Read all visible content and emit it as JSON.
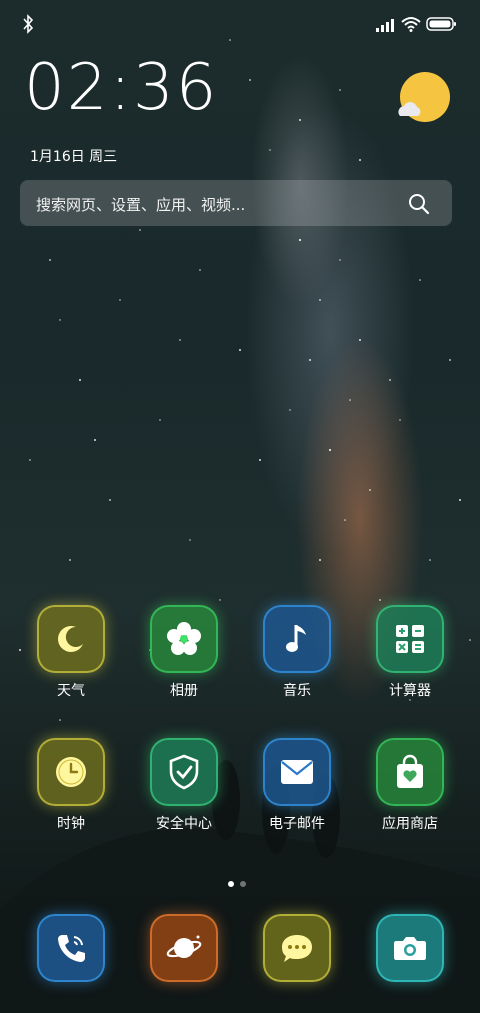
{
  "status": {
    "icons": [
      "bluetooth-icon",
      "signal-icon",
      "wifi-icon",
      "battery-icon"
    ]
  },
  "clock": {
    "time": "02:36",
    "date": "1月16日 周三"
  },
  "weather": {
    "icon": "sun-cloud-icon",
    "color": "#f5c542"
  },
  "search": {
    "placeholder": "搜索网页、设置、应用、视频..."
  },
  "apps_row1": [
    {
      "label": "天气",
      "icon": "moon-icon",
      "color": "#e8e04a"
    },
    {
      "label": "相册",
      "icon": "flower-icon",
      "color": "#3ee06a"
    },
    {
      "label": "音乐",
      "icon": "music-note-icon",
      "color": "#3aa8ff"
    },
    {
      "label": "计算器",
      "icon": "calculator-icon",
      "color": "#3ee08a"
    }
  ],
  "apps_row2": [
    {
      "label": "时钟",
      "icon": "clock-icon",
      "color": "#e8e04a"
    },
    {
      "label": "安全中心",
      "icon": "shield-icon",
      "color": "#3ee08a"
    },
    {
      "label": "电子邮件",
      "icon": "envelope-icon",
      "color": "#3aa8ff"
    },
    {
      "label": "应用商店",
      "icon": "store-bag-icon",
      "color": "#3ee06a"
    }
  ],
  "dock": [
    {
      "icon": "phone-icon",
      "color": "#3aa8ff"
    },
    {
      "icon": "planet-icon",
      "color": "#ff8a3a"
    },
    {
      "icon": "message-icon",
      "color": "#e8e04a"
    },
    {
      "icon": "camera-icon",
      "color": "#3ae0e0"
    }
  ],
  "pager": {
    "count": 2,
    "active": 1
  }
}
